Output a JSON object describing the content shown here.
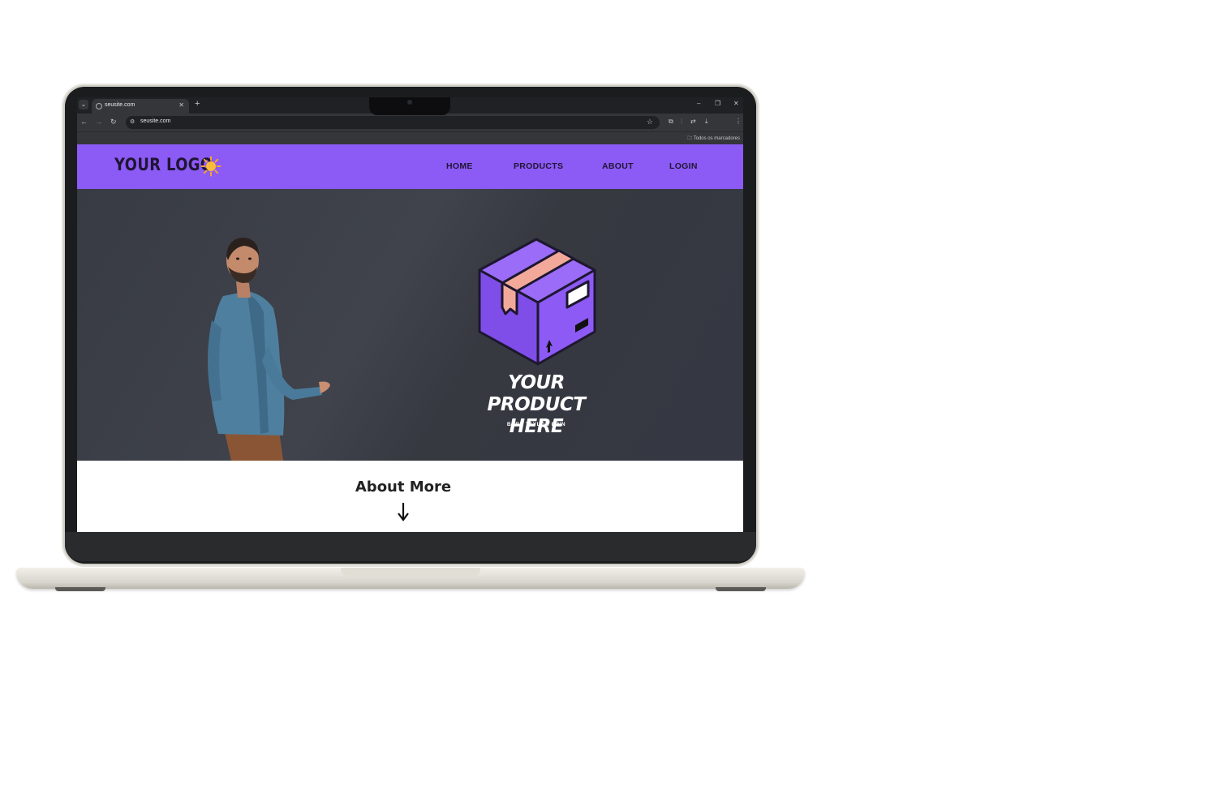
{
  "colors": {
    "brand": "#8c5af5",
    "hero_bg": "#3b3e46",
    "box_purple": "#8d5af5",
    "tape": "#f2a99a"
  },
  "browser": {
    "tab_title": "seusite.com",
    "url": "seusite.com",
    "bookmarks_label": "Todos os marcadores"
  },
  "nav": {
    "logo_text": "YOUR LOGO",
    "logo_icon": "sun-icon",
    "links": [
      "HOME",
      "PRODUCTS",
      "ABOUT",
      "LOGIN"
    ]
  },
  "hero": {
    "product_title_line1": "YOUR PRODUCT",
    "product_title_line2": "HERE",
    "product_subtitle": "BABY TAYLOR FINN"
  },
  "about": {
    "title": "About More",
    "arrow_icon": "arrow-down-icon"
  }
}
